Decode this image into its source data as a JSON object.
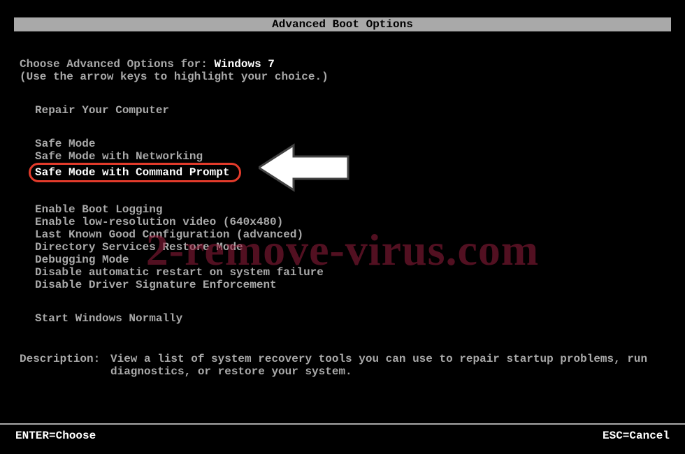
{
  "title": "Advanced Boot Options",
  "choose_prefix": "Choose Advanced Options for: ",
  "os_name": "Windows 7",
  "instruction": "(Use the arrow keys to highlight your choice.)",
  "group1": [
    "Repair Your Computer"
  ],
  "group2": [
    "Safe Mode",
    "Safe Mode with Networking",
    "Safe Mode with Command Prompt"
  ],
  "selected_index": 2,
  "group3": [
    "Enable Boot Logging",
    "Enable low-resolution video (640x480)",
    "Last Known Good Configuration (advanced)",
    "Directory Services Restore Mode",
    "Debugging Mode",
    "Disable automatic restart on system failure",
    "Disable Driver Signature Enforcement"
  ],
  "group4": [
    "Start Windows Normally"
  ],
  "description_label": "Description:",
  "description_text": "View a list of system recovery tools you can use to repair startup problems, run diagnostics, or restore your system.",
  "footer_left": "ENTER=Choose",
  "footer_right": "ESC=Cancel",
  "watermark": "2-remove-virus.com"
}
